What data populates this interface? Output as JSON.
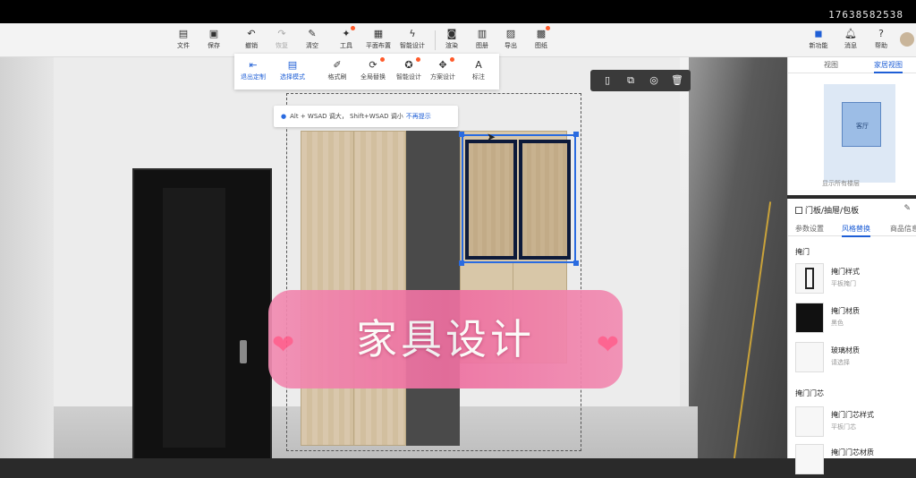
{
  "phone_number": "17638582538",
  "toolbar": {
    "items": [
      {
        "label": "文件",
        "icon": "file-icon"
      },
      {
        "label": "保存",
        "icon": "save-icon"
      },
      {
        "label": "撤销",
        "icon": "undo-icon"
      },
      {
        "label": "恢复",
        "icon": "redo-icon"
      },
      {
        "label": "清空",
        "icon": "clear-icon"
      },
      {
        "label": "工具",
        "icon": "wrench-icon"
      },
      {
        "label": "平面布置",
        "icon": "layout-icon"
      },
      {
        "label": "智能设计",
        "icon": "lightning-icon"
      },
      {
        "label": "渲染",
        "icon": "camera-icon"
      },
      {
        "label": "图册",
        "icon": "album-icon"
      },
      {
        "label": "导出",
        "icon": "export-icon"
      },
      {
        "label": "图纸",
        "icon": "drawing-icon"
      }
    ],
    "right_items": [
      {
        "label": "新功能",
        "icon": "new-feature-icon"
      },
      {
        "label": "消息",
        "icon": "bell-icon"
      },
      {
        "label": "帮助",
        "icon": "help-icon"
      }
    ]
  },
  "subbar": {
    "items": [
      {
        "label": "退出定制",
        "icon": "exit-icon"
      },
      {
        "label": "选择模式",
        "icon": "select-icon"
      },
      {
        "label": "格式刷",
        "icon": "brush-icon"
      },
      {
        "label": "全局替换",
        "icon": "replace-icon"
      },
      {
        "label": "智能设计",
        "icon": "smart-design-icon"
      },
      {
        "label": "方案设计",
        "icon": "scheme-icon"
      },
      {
        "label": "标注",
        "icon": "annotate-icon"
      }
    ]
  },
  "hint": {
    "text": "Alt + WSAD 调大， Shift+WSAD 调小",
    "link": "不再提示"
  },
  "banner_text": "家具设计",
  "right_top": {
    "tabs": [
      "视图",
      "家居视图"
    ],
    "room_label": "客厅",
    "caption": "显示所有楼层"
  },
  "right_bottom": {
    "title": "门板/抽屉/包板",
    "tabs": [
      "参数设置",
      "风格替换",
      "商品信息"
    ],
    "section1": "掩门",
    "props1": [
      {
        "name": "掩门样式",
        "value": "平板掩门"
      },
      {
        "name": "掩门材质",
        "value": "黑色"
      },
      {
        "name": "玻璃材质",
        "value": "请选择"
      }
    ],
    "section2": "掩门门芯",
    "props2": [
      {
        "name": "掩门门芯样式",
        "value": "平板门芯"
      },
      {
        "name": "掩门门芯材质",
        "value": ""
      }
    ]
  }
}
